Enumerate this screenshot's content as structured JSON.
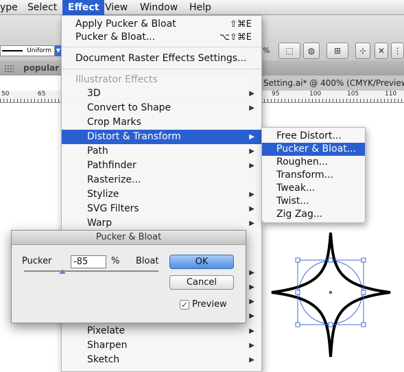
{
  "menubar": {
    "items": [
      {
        "label": "ype"
      },
      {
        "label": "Select"
      },
      {
        "label": "Effect"
      },
      {
        "label": "View"
      },
      {
        "label": "Window"
      },
      {
        "label": "Help"
      }
    ]
  },
  "control_bar": {
    "stroke_profile": "Uniform",
    "percent_label": "%",
    "panel_label": "popular"
  },
  "document": {
    "tab_title": "Setting.ai* @ 400% (CMYK/Preview)"
  },
  "ruler": {
    "numbers": [
      "50",
      "65",
      "95",
      "100",
      "105",
      "110"
    ]
  },
  "effect_menu": {
    "apply_last": {
      "label": "Apply Pucker & Bloat",
      "shortcut": "⇧⌘E"
    },
    "last_effect": {
      "label": "Pucker & Bloat...",
      "shortcut": "⌥⇧⌘E"
    },
    "raster_settings": "Document Raster Effects Settings...",
    "illustrator_header": "Illustrator Effects",
    "items": [
      {
        "label": "3D"
      },
      {
        "label": "Convert to Shape"
      },
      {
        "label": "Crop Marks"
      },
      {
        "label": "Distort & Transform"
      },
      {
        "label": "Path"
      },
      {
        "label": "Pathfinder"
      },
      {
        "label": "Rasterize..."
      },
      {
        "label": "Stylize"
      },
      {
        "label": "SVG Filters"
      },
      {
        "label": "Warp"
      }
    ],
    "lower_items": [
      {
        "label": "Pixelate"
      },
      {
        "label": "Sharpen"
      },
      {
        "label": "Sketch"
      }
    ]
  },
  "submenu": {
    "items": [
      {
        "label": "Free Distort..."
      },
      {
        "label": "Pucker & Bloat..."
      },
      {
        "label": "Roughen..."
      },
      {
        "label": "Transform..."
      },
      {
        "label": "Tweak..."
      },
      {
        "label": "Twist..."
      },
      {
        "label": "Zig Zag..."
      }
    ]
  },
  "dialog": {
    "title": "Pucker & Bloat",
    "pucker_label": "Pucker",
    "amount_value": "-85",
    "percent_sign": "%",
    "bloat_label": "Bloat",
    "ok_label": "OK",
    "cancel_label": "Cancel",
    "preview_label": "Preview",
    "preview_checked": true,
    "slider_range": [
      -200,
      200
    ],
    "slider_value": -85
  },
  "colors": {
    "menu_highlight": "#2a5fcf",
    "selection_blue": "#3b6bd6"
  }
}
